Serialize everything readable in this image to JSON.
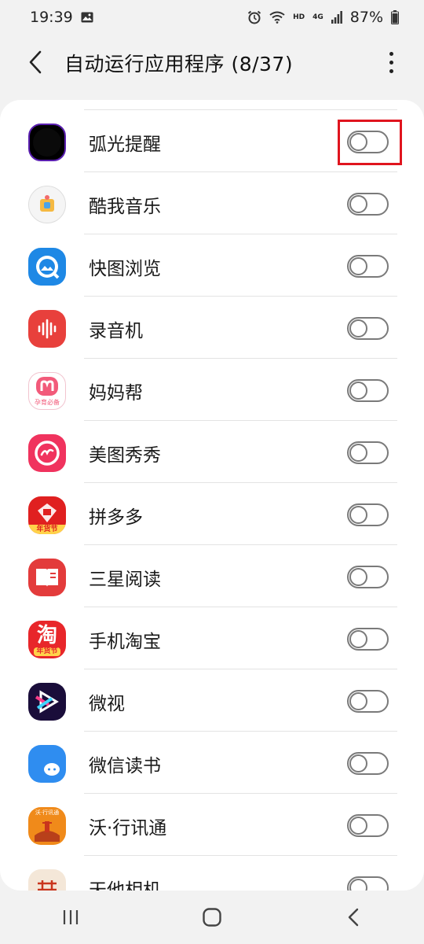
{
  "status_bar": {
    "time": "19:39",
    "battery": "87%",
    "hd_label": "HD",
    "net_label": "4G",
    "icons": [
      "image-icon",
      "alarm-icon",
      "wifi-icon",
      "signal-icon",
      "battery-icon"
    ]
  },
  "header": {
    "title": "自动运行应用程序 (8/37)",
    "back_icon": "back-arrow-icon",
    "more_icon": "more-vert-icon"
  },
  "apps": [
    {
      "label": "弧光提醒",
      "enabled": false,
      "icon": "arc-reminder-icon",
      "color": "#000000"
    },
    {
      "label": "酷我音乐",
      "enabled": false,
      "icon": "kuwo-music-icon",
      "color": "#f5f5f5"
    },
    {
      "label": "快图浏览",
      "enabled": false,
      "icon": "quickpic-icon",
      "color": "#1e88e5"
    },
    {
      "label": "录音机",
      "enabled": false,
      "icon": "voice-recorder-icon",
      "color": "#e8403c"
    },
    {
      "label": "妈妈帮",
      "enabled": false,
      "icon": "mamabang-icon",
      "color": "#f25a7a",
      "badge": "孕育必备"
    },
    {
      "label": "美图秀秀",
      "enabled": false,
      "icon": "meitu-icon",
      "color": "#f0335e"
    },
    {
      "label": "拼多多",
      "enabled": false,
      "icon": "pinduoduo-icon",
      "color": "#e02020",
      "badge": "年货节"
    },
    {
      "label": "三星阅读",
      "enabled": false,
      "icon": "samsung-reader-icon",
      "color": "#e33b3b"
    },
    {
      "label": "手机淘宝",
      "enabled": false,
      "icon": "taobao-icon",
      "color": "#e8262a",
      "badge": "年货节",
      "glyph": "淘"
    },
    {
      "label": "微视",
      "enabled": false,
      "icon": "weishi-icon",
      "color": "#1a0d3a"
    },
    {
      "label": "微信读书",
      "enabled": false,
      "icon": "wechat-read-icon",
      "color": "#2f8df0"
    },
    {
      "label": "沃·行讯通",
      "enabled": false,
      "icon": "wo-xingxuntong-icon",
      "color": "#f08a1a",
      "badge": "沃·行讯通"
    },
    {
      "label": "天他相机",
      "enabled": false,
      "icon": "camera-app-icon",
      "color": "#f4e7d8"
    }
  ],
  "nav_bar": {
    "icons": [
      "recents-icon",
      "home-icon",
      "back-nav-icon"
    ]
  }
}
